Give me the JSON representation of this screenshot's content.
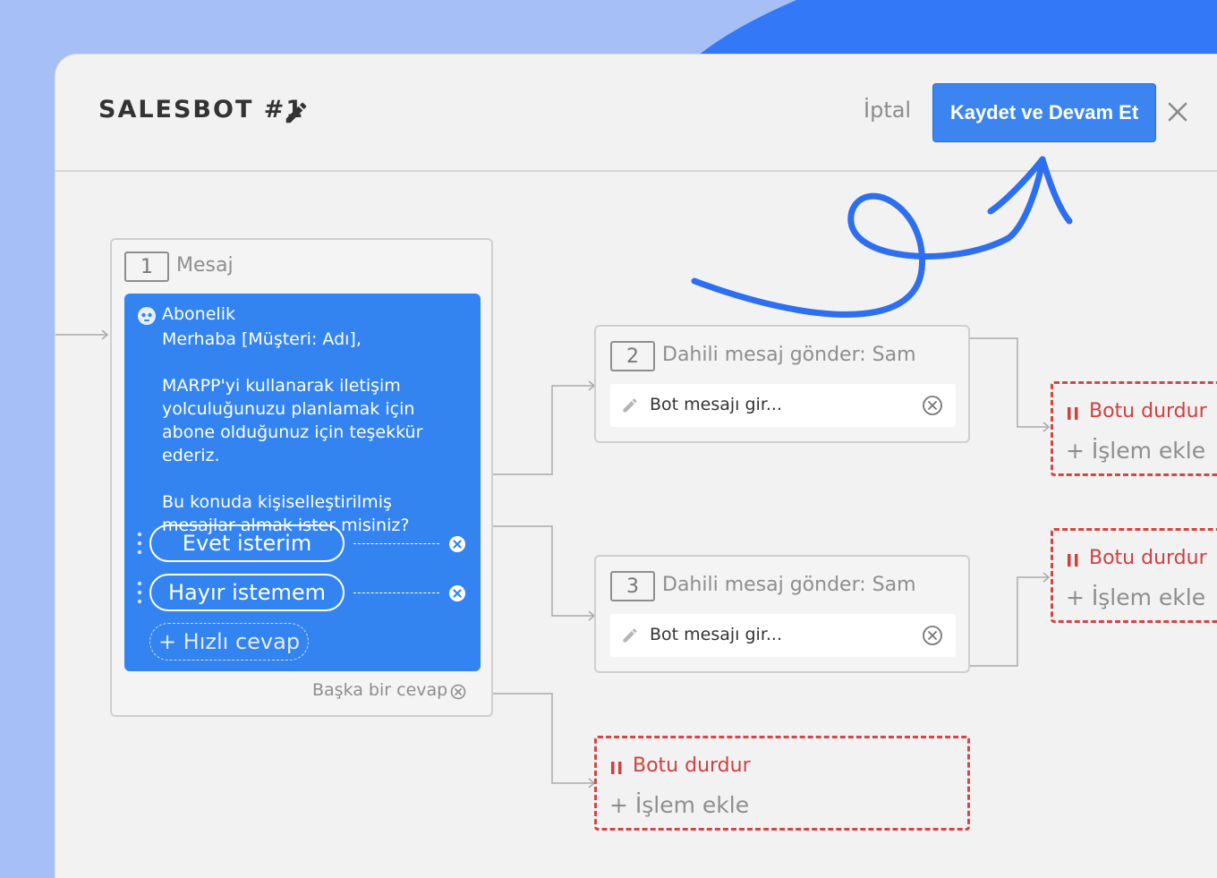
{
  "header": {
    "title": "SALESBOT #1",
    "cancel_label": "İptal",
    "save_label": "Kaydet ve Devam Et"
  },
  "colors": {
    "primary": "#3384f0",
    "stop_red": "#d64545",
    "background": "#a6c0f5"
  },
  "node1": {
    "number": "1",
    "title": "Mesaj",
    "card_title": "Abonelik",
    "message": "Merhaba [Müşteri: Adı],\n\nMARPP'yi kullanarak iletişim yolculuğunuzu planlamak için abone olduğunuz için teşekkür ederiz.\n\nBu konuda kişiselleştirilmiş mesajlar almak ister misiniz?",
    "quick_replies": [
      "Evet isterim",
      "Hayır istemem"
    ],
    "add_quick_reply": "+ Hızlı cevap",
    "other_answer": "Başka bir cevap"
  },
  "node2": {
    "number": "2",
    "title": "Dahili mesaj gönder: Sam",
    "placeholder": "Bot mesajı gir..."
  },
  "node3": {
    "number": "3",
    "title": "Dahili mesaj gönder: Sam",
    "placeholder": "Bot mesajı gir..."
  },
  "stop_nodes": [
    {
      "stop_label": "Botu durdur",
      "add_label": "+ İşlem ekle"
    },
    {
      "stop_label": "Botu durdur",
      "add_label": "+ İşlem ekle"
    },
    {
      "stop_label": "Botu durdur",
      "add_label": "+ İşlem ekle"
    }
  ]
}
